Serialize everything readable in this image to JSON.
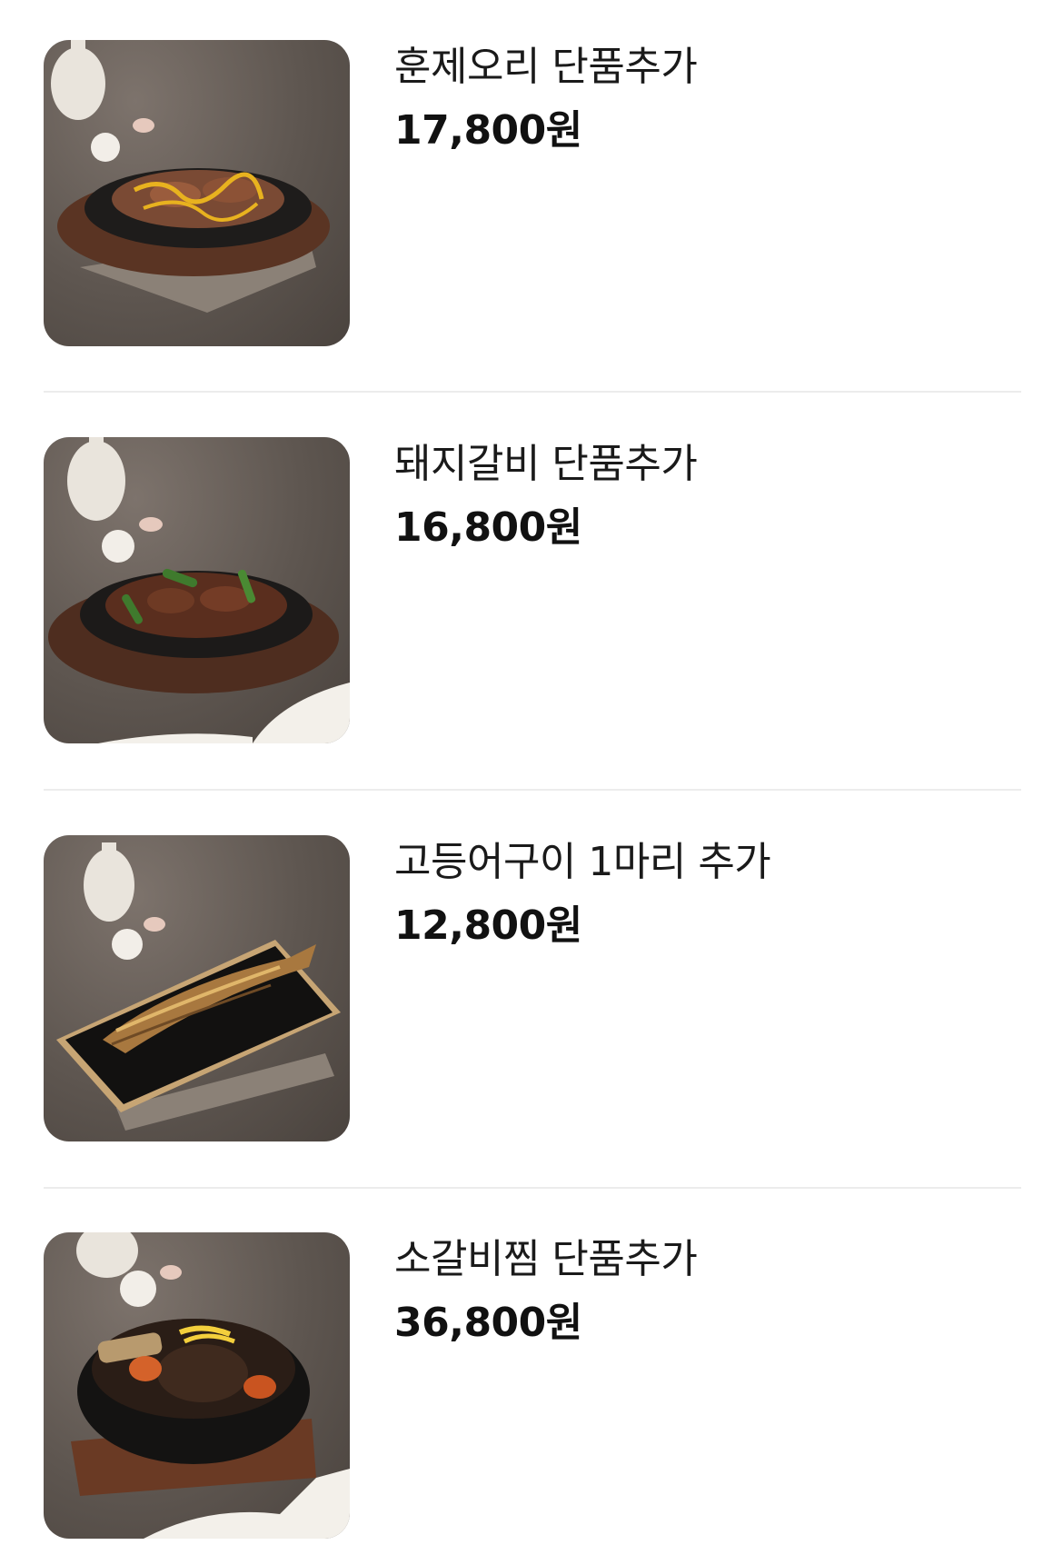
{
  "menu": {
    "items": [
      {
        "name": "훈제오리 단품추가",
        "price": "17,800원",
        "image": "smoked-duck-sizzling-plate"
      },
      {
        "name": "돼지갈비 단품추가",
        "price": "16,800원",
        "image": "pork-galbi-sizzling-plate"
      },
      {
        "name": "고등어구이 1마리 추가",
        "price": "12,800원",
        "image": "grilled-mackerel-tray"
      },
      {
        "name": "소갈비찜 단품추가",
        "price": "36,800원",
        "image": "braised-beef-ribs-clay-pot"
      }
    ]
  }
}
